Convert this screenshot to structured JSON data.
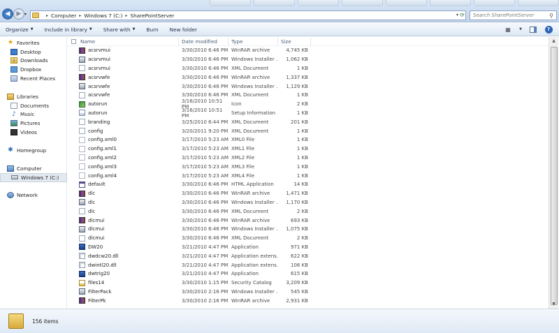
{
  "address": {
    "breadcrumbs": [
      "Computer",
      "Windows 7 (C:)",
      "SharePointServer"
    ],
    "search_placeholder": "Search SharePointServer"
  },
  "toolbar": {
    "organize": "Organize",
    "include_in_library": "Include in library",
    "share_with": "Share with",
    "burn": "Burn",
    "new_folder": "New folder"
  },
  "nav": {
    "favorites": "Favorites",
    "desktop": "Desktop",
    "downloads": "Downloads",
    "dropbox": "Dropbox",
    "recent_places": "Recent Places",
    "libraries": "Libraries",
    "documents": "Documents",
    "music": "Music",
    "pictures": "Pictures",
    "videos": "Videos",
    "homegroup": "Homegroup",
    "computer": "Computer",
    "windows7": "Windows 7 (C:)",
    "network": "Network"
  },
  "columns": {
    "name": "Name",
    "date_modified": "Date modified",
    "type": "Type",
    "size": "Size"
  },
  "files": [
    {
      "name": "acsrvmui",
      "date": "3/30/2010 6:46 PM",
      "type": "WinRAR archive",
      "size": "4,745 KB",
      "icon": "rar"
    },
    {
      "name": "acsrvmui",
      "date": "3/30/2010 6:46 PM",
      "type": "Windows Installer ...",
      "size": "1,062 KB",
      "icon": "msi"
    },
    {
      "name": "acsrvmui",
      "date": "3/30/2010 6:46 PM",
      "type": "XML Document",
      "size": "1 KB",
      "icon": "xml"
    },
    {
      "name": "acsrvwfe",
      "date": "3/30/2010 6:46 PM",
      "type": "WinRAR archive",
      "size": "1,337 KB",
      "icon": "rar"
    },
    {
      "name": "acsrvwfe",
      "date": "3/30/2010 6:46 PM",
      "type": "Windows Installer ...",
      "size": "1,129 KB",
      "icon": "msi"
    },
    {
      "name": "acsrvwfe",
      "date": "3/30/2010 6:46 PM",
      "type": "XML Document",
      "size": "1 KB",
      "icon": "xml"
    },
    {
      "name": "autorun",
      "date": "3/16/2010 10:51 PM",
      "type": "Icon",
      "size": "2 KB",
      "icon": "ico"
    },
    {
      "name": "autorun",
      "date": "3/16/2010 10:51 PM",
      "type": "Setup Information",
      "size": "1 KB",
      "icon": "inf"
    },
    {
      "name": "branding",
      "date": "3/25/2010 6:44 PM",
      "type": "XML Document",
      "size": "201 KB",
      "icon": "xml"
    },
    {
      "name": "config",
      "date": "3/20/2011 9:20 PM",
      "type": "XML Document",
      "size": "1 KB",
      "icon": "xml"
    },
    {
      "name": "config.xml0",
      "date": "3/17/2010 5:23 AM",
      "type": "XML0 File",
      "size": "1 KB",
      "icon": "plain"
    },
    {
      "name": "config.xml1",
      "date": "3/17/2010 5:23 AM",
      "type": "XML1 File",
      "size": "1 KB",
      "icon": "plain"
    },
    {
      "name": "config.xml2",
      "date": "3/17/2010 5:23 AM",
      "type": "XML2 File",
      "size": "1 KB",
      "icon": "plain"
    },
    {
      "name": "config.xml3",
      "date": "3/17/2010 5:23 AM",
      "type": "XML3 File",
      "size": "1 KB",
      "icon": "plain"
    },
    {
      "name": "config.xml4",
      "date": "3/17/2010 5:23 AM",
      "type": "XML4 File",
      "size": "1 KB",
      "icon": "plain"
    },
    {
      "name": "default",
      "date": "3/30/2010 6:46 PM",
      "type": "HTML Application",
      "size": "14 KB",
      "icon": "hta"
    },
    {
      "name": "dlc",
      "date": "3/30/2010 6:46 PM",
      "type": "WinRAR archive",
      "size": "1,471 KB",
      "icon": "rar"
    },
    {
      "name": "dlc",
      "date": "3/30/2010 6:46 PM",
      "type": "Windows Installer ...",
      "size": "1,170 KB",
      "icon": "msi"
    },
    {
      "name": "dlc",
      "date": "3/30/2010 6:46 PM",
      "type": "XML Document",
      "size": "2 KB",
      "icon": "xml"
    },
    {
      "name": "dlcmui",
      "date": "3/30/2010 6:46 PM",
      "type": "WinRAR archive",
      "size": "693 KB",
      "icon": "rar"
    },
    {
      "name": "dlcmui",
      "date": "3/30/2010 6:46 PM",
      "type": "Windows Installer ...",
      "size": "1,075 KB",
      "icon": "msi"
    },
    {
      "name": "dlcmui",
      "date": "3/30/2010 6:46 PM",
      "type": "XML Document",
      "size": "2 KB",
      "icon": "xml"
    },
    {
      "name": "DW20",
      "date": "3/21/2010 4:47 PM",
      "type": "Application",
      "size": "971 KB",
      "icon": "exe"
    },
    {
      "name": "dwdcw20.dll",
      "date": "3/21/2010 4:47 PM",
      "type": "Application extens...",
      "size": "622 KB",
      "icon": "dll"
    },
    {
      "name": "dwintl20.dll",
      "date": "3/21/2010 4:47 PM",
      "type": "Application extens...",
      "size": "106 KB",
      "icon": "dll"
    },
    {
      "name": "dwtrig20",
      "date": "3/21/2010 4:47 PM",
      "type": "Application",
      "size": "615 KB",
      "icon": "exe"
    },
    {
      "name": "files14",
      "date": "3/30/2010 1:15 PM",
      "type": "Security Catalog",
      "size": "3,209 KB",
      "icon": "cat"
    },
    {
      "name": "FilterPack",
      "date": "3/30/2010 2:16 PM",
      "type": "Windows Installer ...",
      "size": "545 KB",
      "icon": "msi"
    },
    {
      "name": "FilterPk",
      "date": "3/30/2010 2:16 PM",
      "type": "WinRAR archive",
      "size": "2,931 KB",
      "icon": "rar"
    }
  ],
  "details": {
    "item_count": "156 items"
  }
}
